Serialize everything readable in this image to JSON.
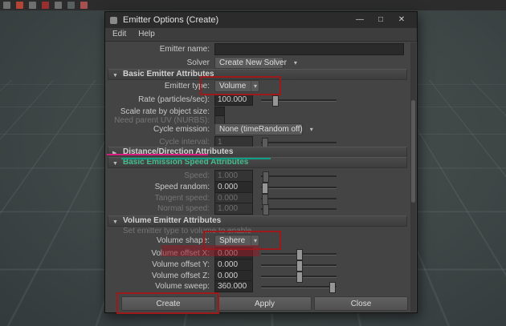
{
  "icons": {
    "dropdown_arrow": "▾",
    "section_expanded": "▼",
    "section_collapsed": "▶",
    "window_minimize": "—",
    "window_maximize": "□",
    "window_close": "✕"
  },
  "colors": {
    "annotation_red": "#9e1a1a",
    "annotation_magenta": "#d81b7f",
    "annotation_green": "#0f9f85",
    "highlighted_section_title": "#45bd8e"
  },
  "window": {
    "title": "Emitter Options (Create)"
  },
  "menubar": {
    "edit": "Edit",
    "help": "Help"
  },
  "form": {
    "emitter_name": {
      "label": "Emitter name:",
      "value": ""
    },
    "solver": {
      "label": "Solver",
      "value": "Create New Solver"
    }
  },
  "sections": {
    "basic_emitter": {
      "title": "Basic Emitter Attributes",
      "rows": {
        "emitter_type": {
          "label": "Emitter type:",
          "value": "Volume"
        },
        "rate": {
          "label": "Rate (particles/sec):",
          "value": "100.000"
        },
        "scale_rate": {
          "label": "Scale rate by object size:"
        },
        "need_parent_uv": {
          "label": "Need parent UV (NURBS):"
        },
        "cycle_emission": {
          "label": "Cycle emission:",
          "value": "None (timeRandom off)"
        },
        "cycle_interval": {
          "label": "Cycle interval:",
          "value": "1"
        }
      }
    },
    "distance_direction": {
      "title": "Distance/Direction Attributes"
    },
    "emission_speed": {
      "title": "Basic Emission Speed Attributes",
      "rows": {
        "speed": {
          "label": "Speed:",
          "value": "1.000"
        },
        "speed_random": {
          "label": "Speed random:",
          "value": "0.000"
        },
        "tangent_speed": {
          "label": "Tangent speed:",
          "value": "0.000"
        },
        "normal_speed": {
          "label": "Normal speed:",
          "value": "1.000"
        }
      }
    },
    "volume_emitter": {
      "title": "Volume Emitter Attributes",
      "hint": "Set emitter type to volume to enable",
      "rows": {
        "volume_shape": {
          "label": "Volume shape:",
          "value": "Sphere"
        },
        "offset_x": {
          "label": "Volume offset X:",
          "value": "0.000"
        },
        "offset_y": {
          "label": "Volume offset Y:",
          "value": "0.000"
        },
        "offset_z": {
          "label": "Volume offset Z:",
          "value": "0.000"
        },
        "sweep": {
          "label": "Volume sweep:",
          "value": "360.000"
        }
      }
    }
  },
  "buttons": {
    "create": "Create",
    "apply": "Apply",
    "close": "Close"
  }
}
